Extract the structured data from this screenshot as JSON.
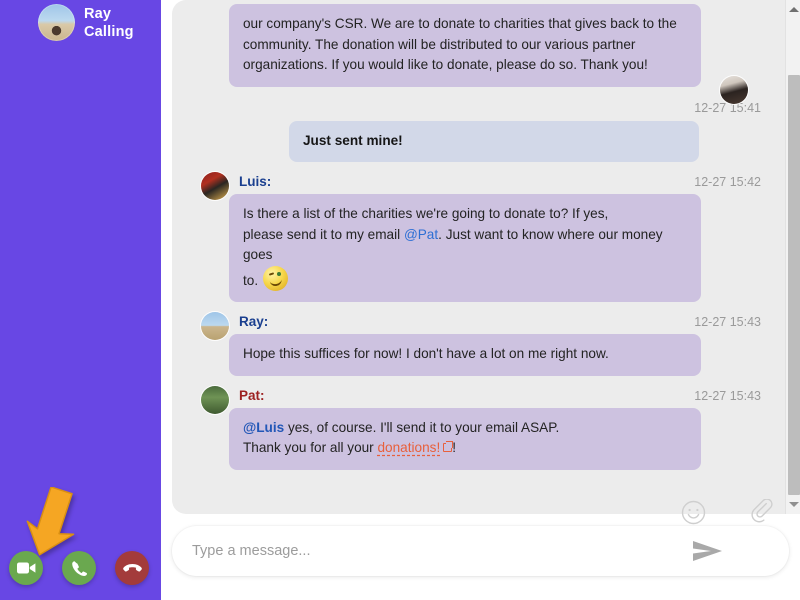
{
  "sidebar": {
    "caller_name": "Ray",
    "caller_status": "Calling",
    "avatar_name": "caller-avatar",
    "buttons": [
      {
        "name": "video-call-button",
        "label": "Video call",
        "icon": "video-camera-icon",
        "color": "#6aa84f"
      },
      {
        "name": "audio-call-button",
        "label": "Audio call",
        "icon": "phone-icon",
        "color": "#6aa84f"
      },
      {
        "name": "hang-up-button",
        "label": "Hang up",
        "icon": "phone-hangup-icon",
        "color": "#a33b3b"
      }
    ],
    "cursor_arrow": {
      "icon": "arrow-pointer-icon",
      "color": "#f5a623",
      "points_to": "video-call-button"
    },
    "background_color": "#6847e4"
  },
  "chat": {
    "messages": [
      {
        "id": "m1",
        "side": "other",
        "sender": "",
        "time": "",
        "avatar": "",
        "partial_top": true,
        "text": "our company's CSR. We are to donate to charities that gives back to the community. The donation will be distributed to our various partner organizations. If you would like to donate, please do so. Thank you!"
      },
      {
        "id": "m2",
        "side": "own",
        "sender": "",
        "time": "12-27 15:41",
        "avatar": "av-me",
        "text": "Just sent mine!"
      },
      {
        "id": "m3",
        "side": "other",
        "sender": "Luis:",
        "sender_color": "#1a3f8f",
        "time": "12-27 15:42",
        "avatar": "av-luis",
        "text_parts": {
          "line1": "Is there a list of the charities we're going to donate to? If yes,",
          "line2a": "please send it to my email ",
          "mention": "@Pat",
          "line2b": ". Just want to know where our money goes",
          "line3": "to.",
          "emoji": "winking-face-emoji"
        }
      },
      {
        "id": "m4",
        "side": "other",
        "sender": "Ray:",
        "sender_color": "#1a3f8f",
        "time": "12-27 15:43",
        "avatar": "av-ray",
        "text": "Hope this suffices for now! I don't have a lot on me right now."
      },
      {
        "id": "m5",
        "side": "other",
        "sender": "Pat:",
        "sender_color": "#9c2020",
        "time": "12-27 15:43",
        "avatar": "av-pat",
        "text_parts": {
          "mention": "@Luis",
          "line1b": " yes, of course. I'll send it to your email ASAP.",
          "line2a": "Thank you for all your ",
          "link": "donations!",
          "line2b": "!"
        }
      }
    ],
    "bubble_color_other": "#cdc2e0",
    "bubble_color_own": "#d2d8e8",
    "panel_background": "#ececec"
  },
  "composer": {
    "placeholder": "Type a message...",
    "value": "",
    "send_label": "Send",
    "emoji_label": "Emoji",
    "attach_label": "Attach file"
  },
  "scrollbar": {
    "up_label": "Scroll up",
    "down_label": "Scroll down"
  }
}
